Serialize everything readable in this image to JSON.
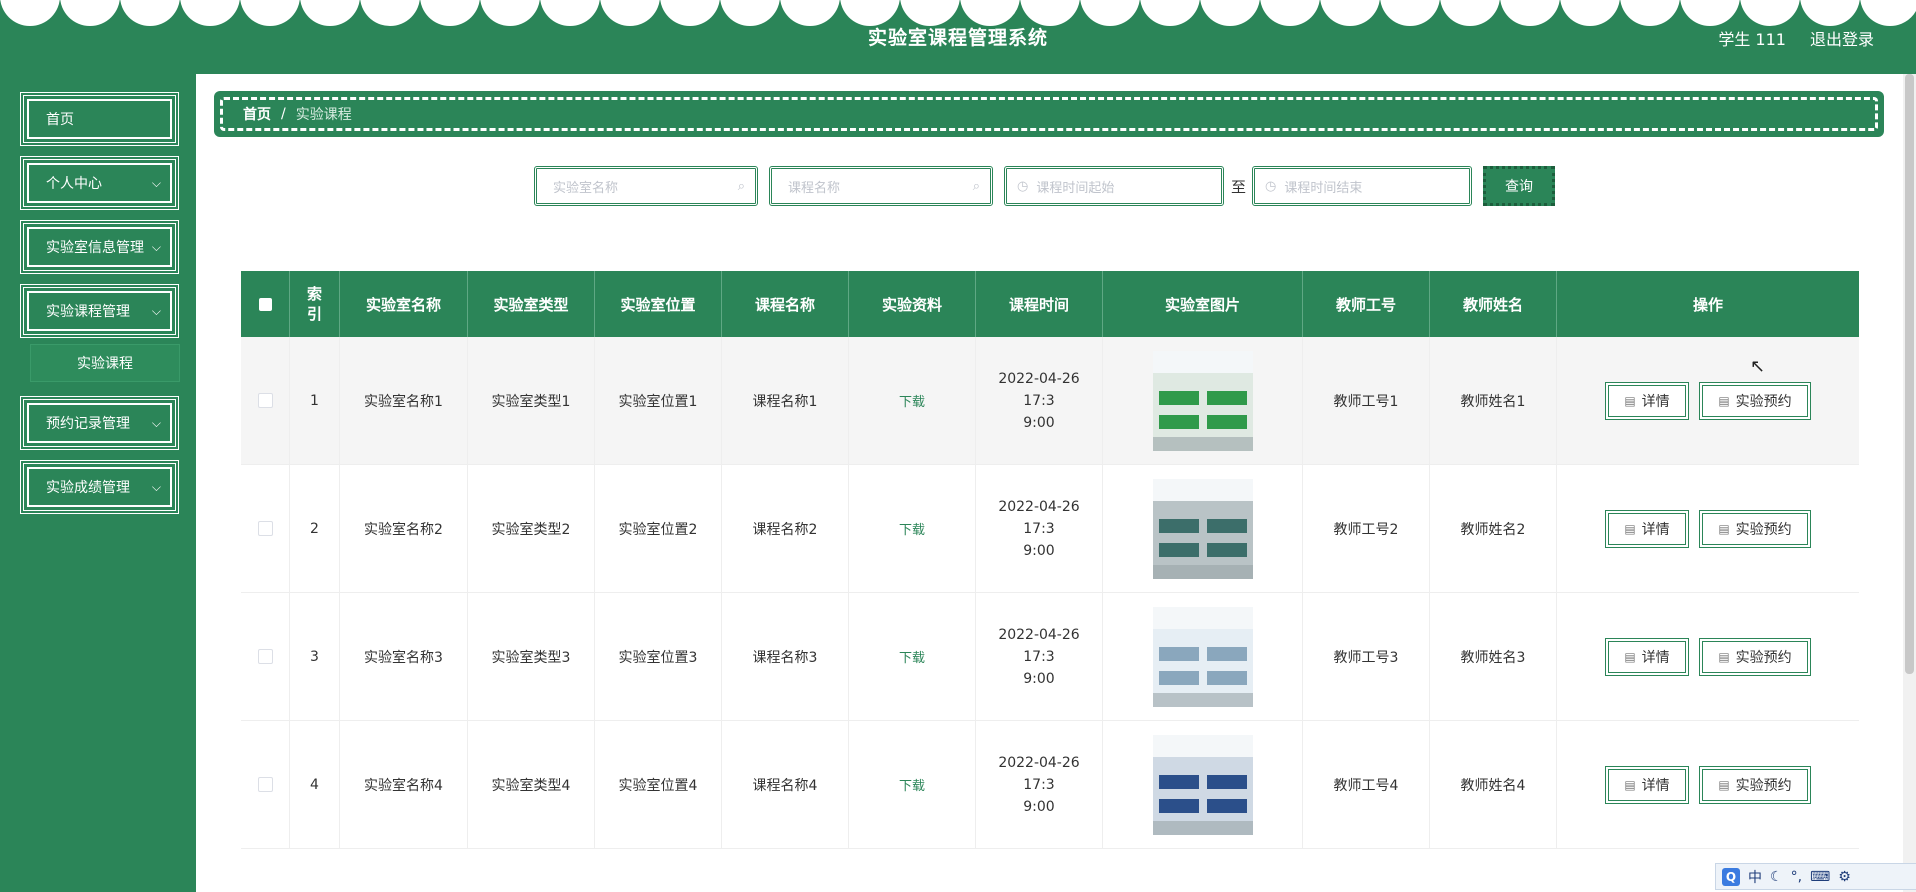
{
  "header": {
    "title": "实验室课程管理系统",
    "user_label": "学生 111",
    "logout_label": "退出登录"
  },
  "sidebar": {
    "items": [
      {
        "label": "首页",
        "has_chevron": false
      },
      {
        "label": "个人中心",
        "has_chevron": true
      },
      {
        "label": "实验室信息管理",
        "has_chevron": true
      },
      {
        "label": "实验课程管理",
        "has_chevron": true
      },
      {
        "label": "预约记录管理",
        "has_chevron": true
      },
      {
        "label": "实验成绩管理",
        "has_chevron": true
      }
    ],
    "sub_item": "实验课程"
  },
  "breadcrumb": {
    "home": "首页",
    "separator": "/",
    "current": "实验课程"
  },
  "search": {
    "lab_name_placeholder": "实验室名称",
    "course_name_placeholder": "课程名称",
    "time_start_placeholder": "课程时间起始",
    "time_end_placeholder": "课程时间结束",
    "to_label": "至",
    "query_label": "查询"
  },
  "table": {
    "headers": [
      "索引",
      "实验室名称",
      "实验室类型",
      "实验室位置",
      "课程名称",
      "实验资料",
      "课程时间",
      "实验室图片",
      "教师工号",
      "教师姓名",
      "操作"
    ],
    "rows": [
      {
        "index": "1",
        "lab_name": "实验室名称1",
        "lab_type": "实验室类型1",
        "lab_location": "实验室位置1",
        "course_name": "课程名称1",
        "material": "下载",
        "time_line1": "2022-04-26 17:3",
        "time_line2": "9:00",
        "teacher_id": "教师工号1",
        "teacher_name": "教师姓名1"
      },
      {
        "index": "2",
        "lab_name": "实验室名称2",
        "lab_type": "实验室类型2",
        "lab_location": "实验室位置2",
        "course_name": "课程名称2",
        "material": "下载",
        "time_line1": "2022-04-26 17:3",
        "time_line2": "9:00",
        "teacher_id": "教师工号2",
        "teacher_name": "教师姓名2"
      },
      {
        "index": "3",
        "lab_name": "实验室名称3",
        "lab_type": "实验室类型3",
        "lab_location": "实验室位置3",
        "course_name": "课程名称3",
        "material": "下载",
        "time_line1": "2022-04-26 17:3",
        "time_line2": "9:00",
        "teacher_id": "教师工号3",
        "teacher_name": "教师姓名3"
      },
      {
        "index": "4",
        "lab_name": "实验室名称4",
        "lab_type": "实验室类型4",
        "lab_location": "实验室位置4",
        "course_name": "课程名称4",
        "material": "下载",
        "time_line1": "2022-04-26 17:3",
        "time_line2": "9:00",
        "teacher_id": "教师工号4",
        "teacher_name": "教师姓名4"
      }
    ],
    "detail_label": "详情",
    "reserve_label": "实验预约"
  },
  "ime_bar": {
    "lang": "中"
  },
  "colors": {
    "primary": "#2b8558",
    "white": "#ffffff"
  }
}
